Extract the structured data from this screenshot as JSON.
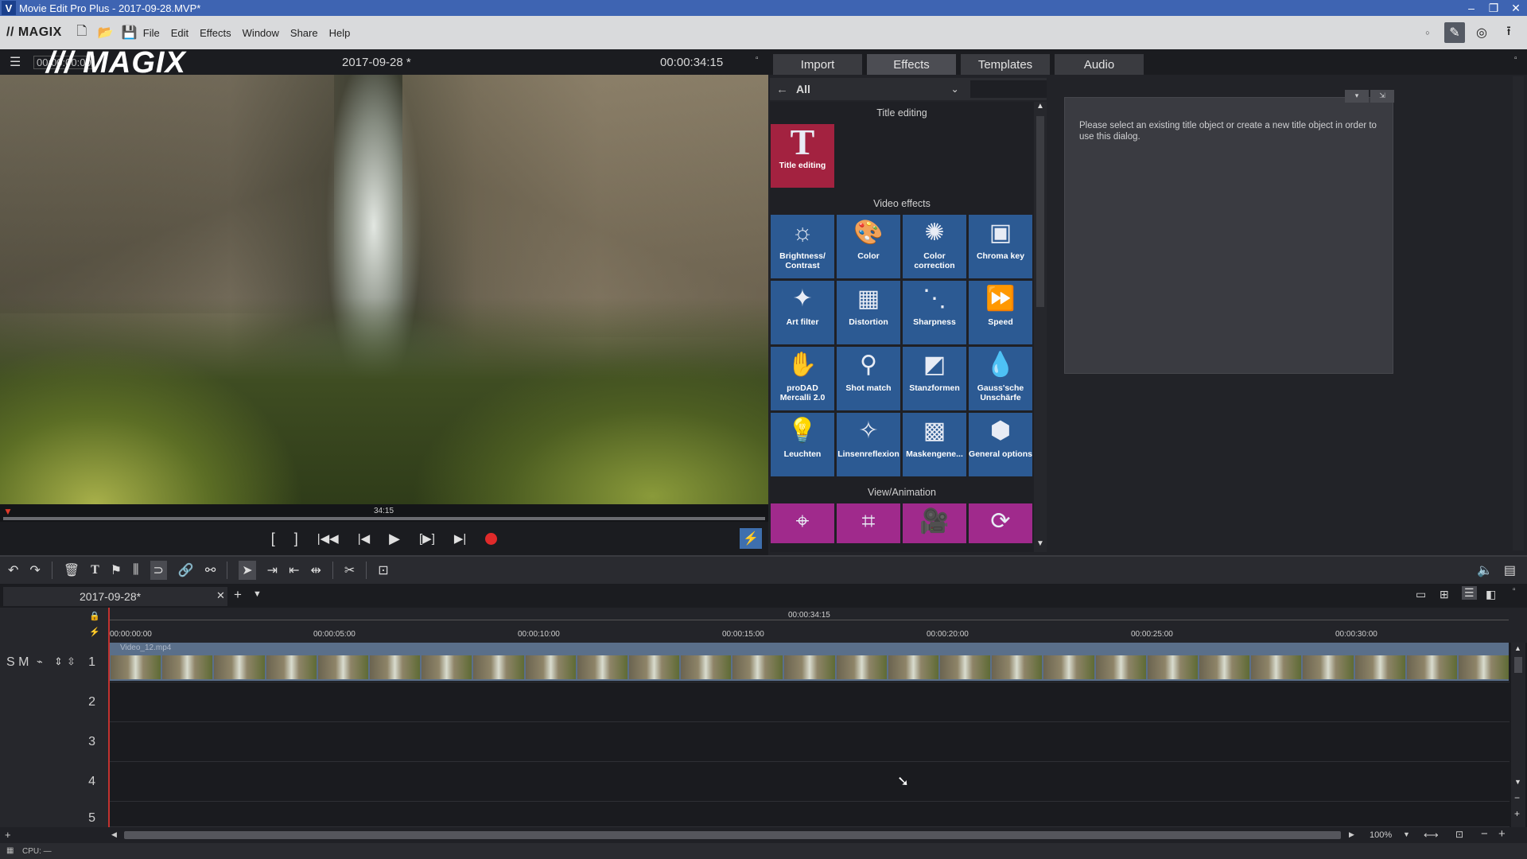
{
  "window": {
    "title": "Movie Edit Pro Plus - 2017-09-28.MVP*",
    "controls": [
      "–",
      "❐",
      "✕"
    ]
  },
  "menu": {
    "logo": "// MAGIX",
    "items": [
      "File",
      "Edit",
      "Effects",
      "Window",
      "Share",
      "Help"
    ]
  },
  "preview": {
    "timecode_left": "00:00:00:00",
    "title": "2017-09-28 *",
    "timecode_right": "00:00:34:15",
    "overlay_logo": "/// MAGIX",
    "scrub_label": "34:15"
  },
  "transport": {
    "buttons": [
      "[",
      "]",
      "|◀◀",
      "|◀",
      "▶",
      "[▶]",
      "▶|"
    ]
  },
  "panel": {
    "tabs": [
      "Import",
      "Effects",
      "Templates",
      "Audio"
    ],
    "active_tab": "Effects",
    "filter": "All",
    "sections": {
      "title_editing": "Title editing",
      "video_effects": "Video effects",
      "view_animation": "View/Animation"
    },
    "title_tile": "Title editing",
    "video_effects": [
      "Brightness/ Contrast",
      "Color",
      "Color correction",
      "Chroma key",
      "Art filter",
      "Distortion",
      "Sharpness",
      "Speed",
      "proDAD Mercalli 2.0",
      "Shot match",
      "Stanzformen",
      "Gauss'sche Unschärfe",
      "Leuchten",
      "Linsenreflexion",
      "Maskengene...",
      "General options"
    ],
    "dialog_text": "Please select an existing title object or create a new title object in order to use this dialog."
  },
  "timeline": {
    "project_tab": "2017-09-28*",
    "ruler_total": "00:00:34:15",
    "ruler_ticks": [
      "00:00:00:00",
      "00:00:05:00",
      "00:00:10:00",
      "00:00:15:00",
      "00:00:20:00",
      "00:00:25:00",
      "00:00:30:00"
    ],
    "track_controls": "S M",
    "tracks": [
      "1",
      "2",
      "3",
      "4",
      "5"
    ],
    "clip_name": "Video_12.mp4",
    "zoom": "100%"
  },
  "status": {
    "cpu": "CPU: —"
  },
  "colors": {
    "accent_blue": "#2c5a93",
    "title_red": "#a32240",
    "anim_magenta": "#a02a8c",
    "record_red": "#e02a2a"
  }
}
